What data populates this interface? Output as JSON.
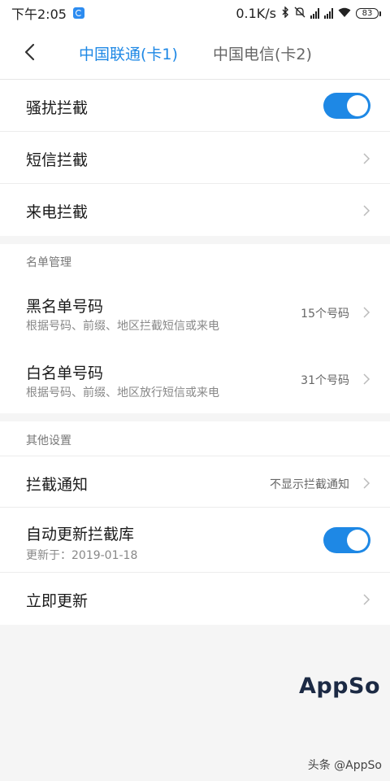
{
  "status_bar": {
    "time": "下午2:05",
    "net_speed": "0.1K/s",
    "battery": "83"
  },
  "header": {
    "tabs": [
      {
        "label": "中国联通(卡1)",
        "active": true
      },
      {
        "label": "中国电信(卡2)",
        "active": false
      }
    ]
  },
  "group1": {
    "items": [
      {
        "title": "骚扰拦截",
        "toggle": true
      },
      {
        "title": "短信拦截"
      },
      {
        "title": "来电拦截"
      }
    ]
  },
  "list_section": {
    "label": "名单管理",
    "items": [
      {
        "title": "黑名单号码",
        "subtitle": "根据号码、前缀、地区拦截短信或来电",
        "value": "15个号码"
      },
      {
        "title": "白名单号码",
        "subtitle": "根据号码、前缀、地区放行短信或来电",
        "value": "31个号码"
      }
    ]
  },
  "other_section": {
    "label": "其他设置",
    "items": [
      {
        "title": "拦截通知",
        "value": "不显示拦截通知"
      },
      {
        "title": "自动更新拦截库",
        "subtitle": "更新于：2019-01-18",
        "toggle": true
      },
      {
        "title": "立即更新"
      }
    ]
  },
  "watermark": "AppSo",
  "credit": "头条 @AppSo",
  "colors": {
    "accent": "#1e88e5",
    "watermark": "#1c2a44"
  }
}
